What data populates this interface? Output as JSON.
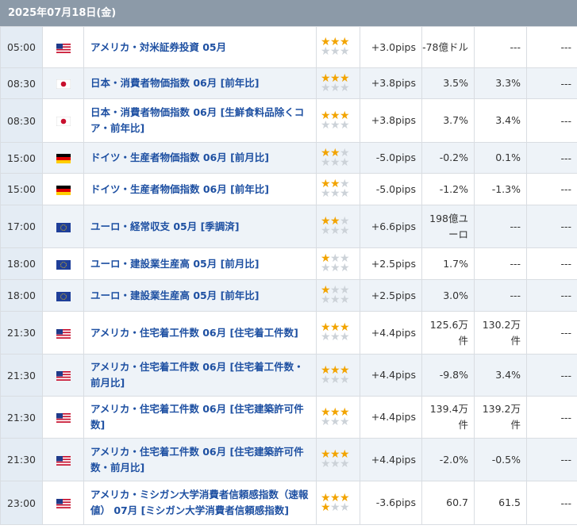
{
  "date": "2025年07月18日(金)",
  "rows": [
    {
      "time": "05:00",
      "flag": "us",
      "event": "アメリカ・対米証券投資 05月",
      "stars": 3,
      "pips": "+3.0pips",
      "prev": "-78億ドル",
      "forecast": "---",
      "actual": "---"
    },
    {
      "time": "08:30",
      "flag": "jp",
      "event": "日本・消費者物価指数 06月 [前年比]",
      "stars": 3,
      "pips": "+3.8pips",
      "prev": "3.5%",
      "forecast": "3.3%",
      "actual": "---"
    },
    {
      "time": "08:30",
      "flag": "jp",
      "event": "日本・消費者物価指数 06月 [生鮮食料品除くコア・前年比]",
      "stars": 3,
      "pips": "+3.8pips",
      "prev": "3.7%",
      "forecast": "3.4%",
      "actual": "---"
    },
    {
      "time": "15:00",
      "flag": "de",
      "event": "ドイツ・生産者物価指数 06月 [前月比]",
      "stars": 2,
      "pips": "-5.0pips",
      "prev": "-0.2%",
      "forecast": "0.1%",
      "actual": "---"
    },
    {
      "time": "15:00",
      "flag": "de",
      "event": "ドイツ・生産者物価指数 06月 [前年比]",
      "stars": 2,
      "pips": "-5.0pips",
      "prev": "-1.2%",
      "forecast": "-1.3%",
      "actual": "---"
    },
    {
      "time": "17:00",
      "flag": "eu",
      "event": "ユーロ・経常収支 05月 [季調済]",
      "stars": 2,
      "pips": "+6.6pips",
      "prev": "198億ユーロ",
      "forecast": "---",
      "actual": "---"
    },
    {
      "time": "18:00",
      "flag": "eu",
      "event": "ユーロ・建設業生産高 05月 [前月比]",
      "stars": 1,
      "pips": "+2.5pips",
      "prev": "1.7%",
      "forecast": "---",
      "actual": "---"
    },
    {
      "time": "18:00",
      "flag": "eu",
      "event": "ユーロ・建設業生産高 05月 [前年比]",
      "stars": 1,
      "pips": "+2.5pips",
      "prev": "3.0%",
      "forecast": "---",
      "actual": "---"
    },
    {
      "time": "21:30",
      "flag": "us",
      "event": "アメリカ・住宅着工件数 06月 [住宅着工件数]",
      "stars": 3,
      "pips": "+4.4pips",
      "prev": "125.6万件",
      "forecast": "130.2万件",
      "actual": "---"
    },
    {
      "time": "21:30",
      "flag": "us",
      "event": "アメリカ・住宅着工件数 06月 [住宅着工件数・前月比]",
      "stars": 3,
      "pips": "+4.4pips",
      "prev": "-9.8%",
      "forecast": "3.4%",
      "actual": "---"
    },
    {
      "time": "21:30",
      "flag": "us",
      "event": "アメリカ・住宅着工件数 06月 [住宅建築許可件数]",
      "stars": 3,
      "pips": "+4.4pips",
      "prev": "139.4万件",
      "forecast": "139.2万件",
      "actual": "---"
    },
    {
      "time": "21:30",
      "flag": "us",
      "event": "アメリカ・住宅着工件数 06月 [住宅建築許可件数・前月比]",
      "stars": 3,
      "pips": "+4.4pips",
      "prev": "-2.0%",
      "forecast": "-0.5%",
      "actual": "---"
    },
    {
      "time": "23:00",
      "flag": "us",
      "event": "アメリカ・ミシガン大学消費者信頼感指数（速報値） 07月 [ミシガン大学消費者信頼感指数]",
      "stars": 4,
      "pips": "-3.6pips",
      "prev": "60.7",
      "forecast": "61.5",
      "actual": "---"
    }
  ]
}
